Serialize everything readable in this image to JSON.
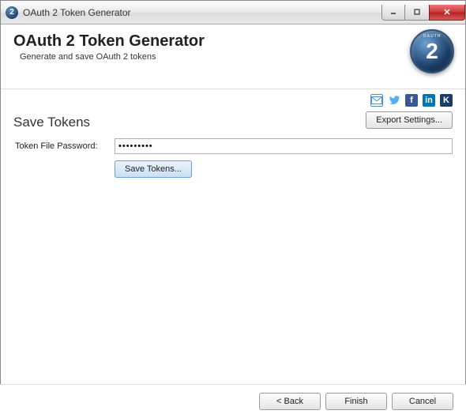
{
  "window": {
    "title": "OAuth 2 Token Generator"
  },
  "header": {
    "title": "OAuth 2 Token Generator",
    "subtitle": "Generate and save OAuth 2 tokens",
    "logo_digit": "2"
  },
  "social": {
    "mail": "mail-icon",
    "twitter": "twitter-icon",
    "facebook": "f",
    "linkedin": "in",
    "k": "K"
  },
  "section": {
    "title": "Save Tokens",
    "export_label": "Export Settings...",
    "password_label": "Token File Password:",
    "password_value": "●●●●●●●●●",
    "save_label": "Save Tokens..."
  },
  "footer": {
    "back": "< Back",
    "finish": "Finish",
    "cancel": "Cancel"
  }
}
